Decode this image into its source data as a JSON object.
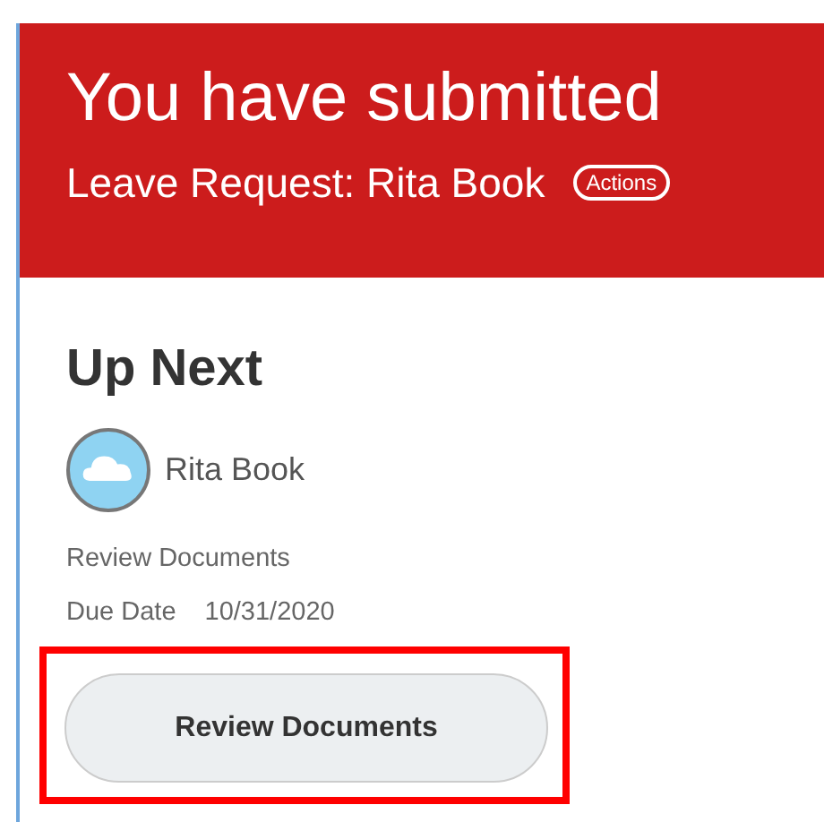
{
  "header": {
    "title": "You have submitted",
    "subtitle": "Leave Request: Rita Book",
    "actions_button": "Actions"
  },
  "up_next": {
    "heading": "Up Next",
    "person": "Rita Book",
    "task": "Review Documents",
    "due_label": "Due Date",
    "due_date": "10/31/2020",
    "button": {
      "label": "Review Documents",
      "highlighted": true
    }
  }
}
